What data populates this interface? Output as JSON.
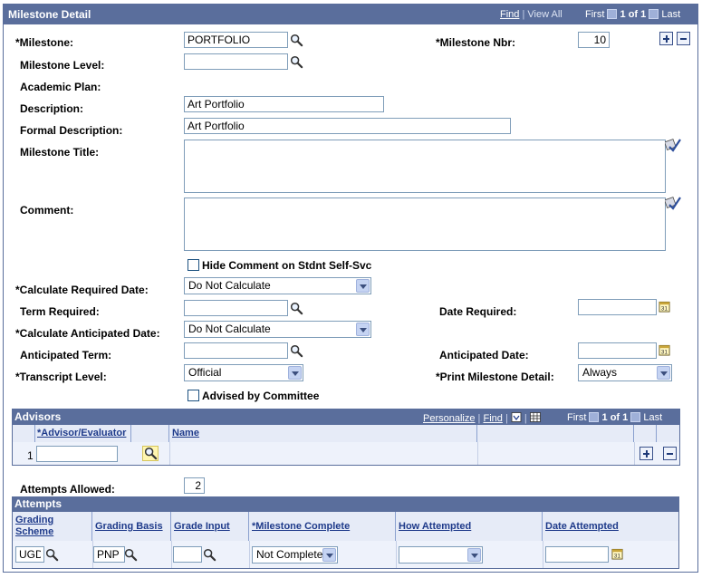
{
  "header": {
    "title": "Milestone Detail",
    "find": "Find",
    "view_all": "View All",
    "first": "First",
    "counter": "1 of 1",
    "last": "Last"
  },
  "form": {
    "milestone": {
      "label": "*Milestone:",
      "value": "PORTFOLIO"
    },
    "milestone_nbr": {
      "label": "*Milestone Nbr:",
      "value": "10"
    },
    "milestone_level": {
      "label": "Milestone Level:",
      "value": ""
    },
    "academic_plan": {
      "label": "Academic Plan:"
    },
    "description": {
      "label": "Description:",
      "value": "Art Portfolio"
    },
    "formal_description": {
      "label": "Formal Description:",
      "value": "Art Portfolio"
    },
    "milestone_title": {
      "label": "Milestone Title:"
    },
    "comment": {
      "label": "Comment:"
    },
    "hide_comment": {
      "label": "Hide Comment on Stdnt Self-Svc"
    },
    "calc_required_date": {
      "label": "*Calculate Required Date:",
      "value": "Do Not Calculate"
    },
    "term_required": {
      "label": "Term Required:",
      "value": ""
    },
    "date_required": {
      "label": "Date Required:",
      "value": ""
    },
    "calc_anticipated_date": {
      "label": "*Calculate Anticipated Date:",
      "value": "Do Not Calculate"
    },
    "anticipated_term": {
      "label": "Anticipated Term:",
      "value": ""
    },
    "anticipated_date": {
      "label": "Anticipated Date:",
      "value": ""
    },
    "transcript_level": {
      "label": "*Transcript Level:",
      "value": "Official"
    },
    "print_milestone_detail": {
      "label": "*Print Milestone Detail:",
      "value": "Always"
    },
    "advised_by_committee": {
      "label": "Advised by Committee"
    }
  },
  "advisors": {
    "title": "Advisors",
    "personalize": "Personalize",
    "find": "Find",
    "first": "First",
    "counter": "1 of 1",
    "last": "Last",
    "columns": [
      "*Advisor/Evaluator",
      "Name"
    ],
    "row_num": "1",
    "advisor_value": ""
  },
  "attempts_allowed": {
    "label": "Attempts Allowed:",
    "value": "2"
  },
  "attempts": {
    "title": "Attempts",
    "columns": [
      "Grading Scheme",
      "Grading Basis",
      "Grade Input",
      "*Milestone Complete",
      "How Attempted",
      "Date Attempted"
    ],
    "row": {
      "grading_scheme": "UGD",
      "grading_basis": "PNP",
      "grade_input": "",
      "milestone_complete": "Not Complete",
      "how_attempted": "",
      "date_attempted": ""
    }
  },
  "colors": {
    "header_bg": "#5a6e9c",
    "column_header_bg": "#e6ebf7",
    "row_bg": "#eef2fb",
    "link": "#1e3a8a"
  },
  "icons": [
    "lookup-icon",
    "calendar-icon",
    "spell-check-icon",
    "add-row-icon",
    "delete-row-icon",
    "first-arrow-icon",
    "next-arrow-icon",
    "download-icon",
    "view-grid-icon"
  ]
}
